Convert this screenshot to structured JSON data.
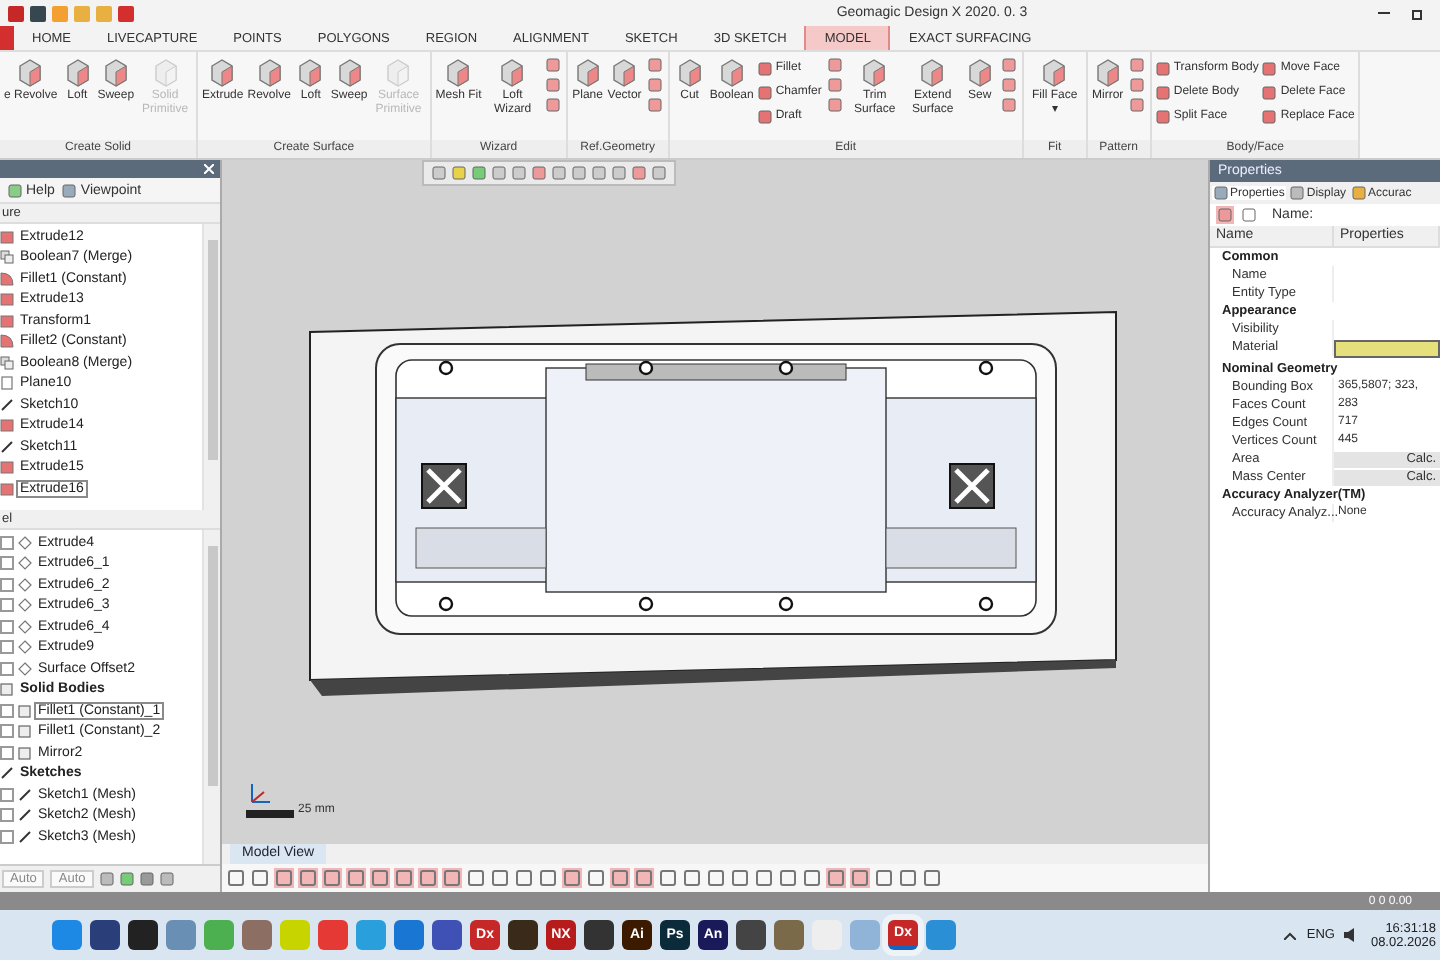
{
  "window": {
    "title": "Geomagic Design X 2020. 0. 3"
  },
  "tabs": [
    {
      "label": "HOME",
      "selected": false
    },
    {
      "label": "LIVECAPTURE",
      "selected": false
    },
    {
      "label": "POINTS",
      "selected": false
    },
    {
      "label": "POLYGONS",
      "selected": false
    },
    {
      "label": "REGION",
      "selected": false
    },
    {
      "label": "ALIGNMENT",
      "selected": false
    },
    {
      "label": "SKETCH",
      "selected": false
    },
    {
      "label": "3D SKETCH",
      "selected": false
    },
    {
      "label": "MODEL",
      "selected": true
    },
    {
      "label": "EXACT SURFACING",
      "selected": false
    }
  ],
  "ribbon": [
    {
      "name": "Create Solid",
      "buttons": [
        {
          "kind": "large",
          "label": "e Revolve",
          "disabled": false
        },
        {
          "kind": "large",
          "label": "Loft",
          "disabled": false
        },
        {
          "kind": "large",
          "label": "Sweep",
          "disabled": false
        },
        {
          "kind": "large",
          "label": "Solid Primitive",
          "disabled": true
        }
      ]
    },
    {
      "name": "Create Surface",
      "buttons": [
        {
          "kind": "large",
          "label": "Extrude",
          "disabled": false
        },
        {
          "kind": "large",
          "label": "Revolve",
          "disabled": false
        },
        {
          "kind": "large",
          "label": "Loft",
          "disabled": false
        },
        {
          "kind": "large",
          "label": "Sweep",
          "disabled": false
        },
        {
          "kind": "large",
          "label": "Surface Primitive",
          "disabled": true
        }
      ]
    },
    {
      "name": "Wizard",
      "buttons": [
        {
          "kind": "large",
          "label": "Mesh Fit",
          "disabled": false
        },
        {
          "kind": "large",
          "label": "Loft Wizard",
          "disabled": false
        },
        {
          "kind": "stack"
        }
      ]
    },
    {
      "name": "Ref.Geometry",
      "buttons": [
        {
          "kind": "large",
          "label": "Plane",
          "disabled": false
        },
        {
          "kind": "large",
          "label": "Vector",
          "disabled": false
        },
        {
          "kind": "stack"
        }
      ]
    },
    {
      "name": "Edit",
      "buttons": [
        {
          "kind": "large",
          "label": "Cut",
          "disabled": false
        },
        {
          "kind": "large",
          "label": "Boolean",
          "disabled": false
        },
        {
          "kind": "small",
          "items": [
            "Fillet",
            "Chamfer",
            "Draft"
          ]
        },
        {
          "kind": "stack"
        },
        {
          "kind": "large",
          "label": "Trim Surface",
          "disabled": false
        },
        {
          "kind": "large",
          "label": "Extend Surface",
          "disabled": false
        },
        {
          "kind": "large",
          "label": "Sew",
          "disabled": false
        },
        {
          "kind": "stack"
        }
      ]
    },
    {
      "name": "Fit",
      "buttons": [
        {
          "kind": "large",
          "label": "Fill Face ▾",
          "disabled": false
        }
      ]
    },
    {
      "name": "Pattern",
      "buttons": [
        {
          "kind": "large",
          "label": "Mirror",
          "disabled": false
        },
        {
          "kind": "stack"
        }
      ]
    },
    {
      "name": "Body/Face",
      "buttons": [
        {
          "kind": "small",
          "items": [
            "Transform Body",
            "Delete Body",
            "Split Face"
          ]
        },
        {
          "kind": "small",
          "items": [
            "Move Face",
            "Delete Face",
            "Replace Face"
          ]
        }
      ]
    }
  ],
  "feature_panel": {
    "tools": [
      "Help",
      "Viewpoint"
    ],
    "section": "ure",
    "items": [
      {
        "label": "Extrude12",
        "kind": "solid",
        "selected": false
      },
      {
        "label": "Boolean7 (Merge)",
        "kind": "boolean",
        "selected": false
      },
      {
        "label": "Fillet1 (Constant)",
        "kind": "fillet",
        "selected": false
      },
      {
        "label": "Extrude13",
        "kind": "solid",
        "selected": false
      },
      {
        "label": "Transform1",
        "kind": "solid",
        "selected": false
      },
      {
        "label": "Fillet2 (Constant)",
        "kind": "fillet",
        "selected": false
      },
      {
        "label": "Boolean8 (Merge)",
        "kind": "boolean",
        "selected": false
      },
      {
        "label": "Plane10",
        "kind": "plane",
        "selected": false
      },
      {
        "label": "Sketch10",
        "kind": "sketch",
        "selected": false
      },
      {
        "label": "Extrude14",
        "kind": "solid",
        "selected": false
      },
      {
        "label": "Sketch11",
        "kind": "sketch",
        "selected": false
      },
      {
        "label": "Extrude15",
        "kind": "solid",
        "selected": false
      },
      {
        "label": "Extrude16",
        "kind": "solid",
        "selected": true
      }
    ]
  },
  "model_panel": {
    "section": "el",
    "surfaces": [
      {
        "label": "Extrude4",
        "checked": false,
        "selected": false
      },
      {
        "label": "Extrude6_1",
        "checked": false,
        "selected": false
      },
      {
        "label": "Extrude6_2",
        "checked": false,
        "selected": false
      },
      {
        "label": "Extrude6_3",
        "checked": false,
        "selected": false
      },
      {
        "label": "Extrude6_4",
        "checked": false,
        "selected": false
      },
      {
        "label": "Extrude9",
        "checked": false,
        "selected": false
      },
      {
        "label": "Surface Offset2",
        "checked": false,
        "selected": false
      }
    ],
    "groups": [
      {
        "kind": "body",
        "label": "Solid Bodies",
        "children": [
          {
            "label": "Fillet1 (Constant)_1",
            "checked": false,
            "selected": true
          },
          {
            "label": "Fillet1 (Constant)_2",
            "checked": false,
            "selected": false
          },
          {
            "label": "Mirror2",
            "checked": false,
            "selected": false
          }
        ]
      },
      {
        "kind": "sketch",
        "label": "Sketches",
        "children": [
          {
            "label": "Sketch1 (Mesh)",
            "checked": false,
            "selected": false
          },
          {
            "label": "Sketch2 (Mesh)",
            "checked": false,
            "selected": false
          },
          {
            "label": "Sketch3 (Mesh)",
            "checked": false,
            "selected": false
          }
        ]
      }
    ],
    "selects": [
      "Auto",
      "Auto"
    ]
  },
  "viewport": {
    "scale": "25 mm",
    "tab": "Model View",
    "tools": [
      {
        "on": false
      },
      {
        "on": false
      },
      {
        "on": true
      },
      {
        "on": true
      },
      {
        "on": true
      },
      {
        "on": true
      },
      {
        "on": true
      },
      {
        "on": true
      },
      {
        "on": true
      },
      {
        "on": true
      },
      {
        "on": false
      },
      {
        "on": false
      },
      {
        "on": false
      },
      {
        "on": false
      },
      {
        "on": true
      },
      {
        "on": false
      },
      {
        "on": true
      },
      {
        "on": true
      },
      {
        "on": false
      },
      {
        "on": false
      },
      {
        "on": false
      },
      {
        "on": false
      },
      {
        "on": false
      },
      {
        "on": false
      },
      {
        "on": false
      },
      {
        "on": true
      },
      {
        "on": true
      },
      {
        "on": false
      },
      {
        "on": false
      },
      {
        "on": false
      }
    ]
  },
  "properties": {
    "title": "Properties",
    "tabs": [
      {
        "label": "Properties",
        "selected": true
      },
      {
        "label": "Display",
        "selected": false
      },
      {
        "label": "Accurac",
        "selected": false
      }
    ],
    "name_label": "Name:",
    "columns": [
      "Name",
      "Properties"
    ],
    "rows": [
      {
        "kind": "category",
        "name": "Common"
      },
      {
        "kind": "text",
        "name": "Name"
      },
      {
        "kind": "text",
        "name": "Entity Type"
      },
      {
        "kind": "category",
        "name": "Appearance"
      },
      {
        "kind": "text",
        "name": "Visibility"
      },
      {
        "kind": "swatch",
        "name": "Material",
        "color": "#e6e07c"
      },
      {
        "kind": "category",
        "name": "Nominal Geometry"
      },
      {
        "kind": "text",
        "name": "Bounding Box",
        "value": "365,5807; 323,"
      },
      {
        "kind": "text",
        "name": "Faces Count",
        "value": "283"
      },
      {
        "kind": "text",
        "name": "Edges Count",
        "value": "717"
      },
      {
        "kind": "text",
        "name": "Vertices Count",
        "value": "445"
      },
      {
        "kind": "button",
        "name": "Area",
        "value": "Calc."
      },
      {
        "kind": "button",
        "name": "Mass Center",
        "value": "Calc."
      },
      {
        "kind": "category",
        "name": "Accuracy Analyzer(TM)"
      },
      {
        "kind": "text",
        "name": "Accuracy Analyz...",
        "value": "None"
      }
    ]
  },
  "status_bar": {
    "text": "0 0 0.00"
  },
  "taskbar": {
    "apps": [
      {
        "color": "#1e88e5",
        "active": false
      },
      {
        "color": "#2a3f7a",
        "active": false
      },
      {
        "color": "#222222",
        "active": false
      },
      {
        "color": "#6a8fb5",
        "active": false
      },
      {
        "color": "#4caf50",
        "active": false
      },
      {
        "color": "#8d6e63",
        "active": false
      },
      {
        "color": "#c8d400",
        "active": false
      },
      {
        "color": "#e53935",
        "active": false
      },
      {
        "color": "#29a0dc",
        "active": false
      },
      {
        "color": "#1976d2",
        "active": false
      },
      {
        "color": "#3f51b5",
        "active": false
      },
      {
        "color": "#c62828",
        "label": "Dx",
        "active": false
      },
      {
        "color": "#3a2a1a",
        "active": false
      },
      {
        "color": "#b71c1c",
        "label": "NX",
        "active": false
      },
      {
        "color": "#333333",
        "active": false
      },
      {
        "color": "#3b1a00",
        "label": "Ai",
        "active": false
      },
      {
        "color": "#0b2a3a",
        "label": "Ps",
        "active": false
      },
      {
        "color": "#1a1a5a",
        "label": "An",
        "active": false
      },
      {
        "color": "#444444",
        "active": false
      },
      {
        "color": "#7a6a4a",
        "active": false
      },
      {
        "color": "#eeeeee",
        "active": false
      },
      {
        "color": "#90b4d8",
        "active": false
      },
      {
        "color": "#c62828",
        "label": "Dx",
        "active": true
      },
      {
        "color": "#2b8fd6",
        "active": false
      }
    ],
    "language": "ENG",
    "time": "16:31:18",
    "date": "08.02.2026"
  }
}
